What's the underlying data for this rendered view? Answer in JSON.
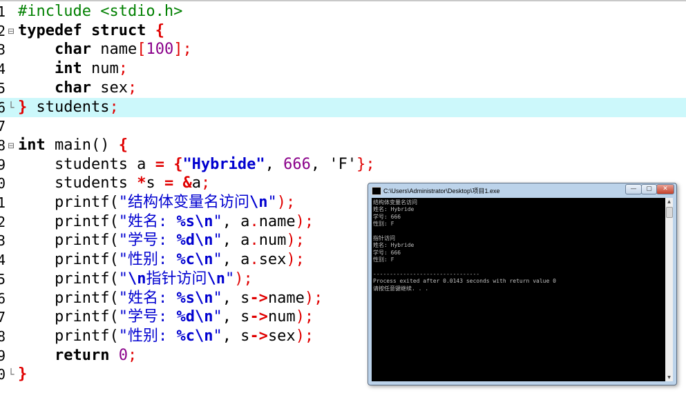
{
  "editor": {
    "lines": [
      {
        "n": "1",
        "fold": "",
        "seg": [
          {
            "t": "#include <stdio.h>",
            "c": "pre"
          }
        ]
      },
      {
        "n": "2",
        "fold": "⊟",
        "seg": [
          {
            "t": "typedef struct ",
            "c": "kw"
          },
          {
            "t": "{",
            "c": "brace"
          }
        ]
      },
      {
        "n": "3",
        "fold": "",
        "seg": [
          {
            "t": "    "
          },
          {
            "t": "char",
            "c": "kw"
          },
          {
            "t": " name"
          },
          {
            "t": "[",
            "c": "punc"
          },
          {
            "t": "100",
            "c": "num"
          },
          {
            "t": "];",
            "c": "punc"
          }
        ]
      },
      {
        "n": "4",
        "fold": "",
        "seg": [
          {
            "t": "    "
          },
          {
            "t": "int",
            "c": "kw"
          },
          {
            "t": " num"
          },
          {
            "t": ";",
            "c": "punc"
          }
        ]
      },
      {
        "n": "5",
        "fold": "",
        "seg": [
          {
            "t": "    "
          },
          {
            "t": "char",
            "c": "kw"
          },
          {
            "t": " sex"
          },
          {
            "t": ";",
            "c": "punc"
          }
        ]
      },
      {
        "n": "6",
        "fold": "└",
        "highlight": true,
        "seg": [
          {
            "t": "}",
            "c": "brace"
          },
          {
            "t": " students"
          },
          {
            "t": ";",
            "c": "punc"
          }
        ]
      },
      {
        "n": "7",
        "fold": "",
        "seg": []
      },
      {
        "n": "8",
        "fold": "⊟",
        "seg": [
          {
            "t": "int",
            "c": "kw"
          },
          {
            "t": " main() "
          },
          {
            "t": "{",
            "c": "brace"
          }
        ]
      },
      {
        "n": "9",
        "fold": "",
        "seg": [
          {
            "t": "    students a "
          },
          {
            "t": "=",
            "c": "op"
          },
          {
            "t": " "
          },
          {
            "t": "{",
            "c": "brace"
          },
          {
            "t": "\"Hybride\"",
            "c": "esc"
          },
          {
            "t": ","
          },
          {
            "t": " 666",
            "c": "num"
          },
          {
            "t": ", 'F'"
          },
          {
            "t": "};",
            "c": "punc"
          }
        ]
      },
      {
        "n": "0",
        "fold": "",
        "seg": [
          {
            "t": "    students "
          },
          {
            "t": "*",
            "c": "op"
          },
          {
            "t": "s "
          },
          {
            "t": "=",
            "c": "op"
          },
          {
            "t": " "
          },
          {
            "t": "&",
            "c": "op"
          },
          {
            "t": "a"
          },
          {
            "t": ";",
            "c": "punc"
          }
        ]
      },
      {
        "n": "1",
        "fold": "",
        "seg": [
          {
            "t": "    printf("
          },
          {
            "t": "\"结构体变量名访问",
            "c": "str"
          },
          {
            "t": "\\n",
            "c": "esc"
          },
          {
            "t": "\"",
            "c": "str"
          },
          {
            "t": ");",
            "c": "punc"
          }
        ]
      },
      {
        "n": "2",
        "fold": "",
        "seg": [
          {
            "t": "    printf("
          },
          {
            "t": "\"姓名: ",
            "c": "str"
          },
          {
            "t": "%s\\n",
            "c": "esc"
          },
          {
            "t": "\"",
            "c": "str"
          },
          {
            "t": ", a"
          },
          {
            "t": ".",
            "c": "punc"
          },
          {
            "t": "name"
          },
          {
            "t": ");",
            "c": "punc"
          }
        ]
      },
      {
        "n": "3",
        "fold": "",
        "seg": [
          {
            "t": "    printf("
          },
          {
            "t": "\"学号: ",
            "c": "str"
          },
          {
            "t": "%d\\n",
            "c": "esc"
          },
          {
            "t": "\"",
            "c": "str"
          },
          {
            "t": ", a"
          },
          {
            "t": ".",
            "c": "punc"
          },
          {
            "t": "num"
          },
          {
            "t": ");",
            "c": "punc"
          }
        ]
      },
      {
        "n": "4",
        "fold": "",
        "seg": [
          {
            "t": "    printf("
          },
          {
            "t": "\"性别: ",
            "c": "str"
          },
          {
            "t": "%c\\n",
            "c": "esc"
          },
          {
            "t": "\"",
            "c": "str"
          },
          {
            "t": ", a"
          },
          {
            "t": ".",
            "c": "punc"
          },
          {
            "t": "sex"
          },
          {
            "t": ");",
            "c": "punc"
          }
        ]
      },
      {
        "n": "5",
        "fold": "",
        "seg": [
          {
            "t": "    printf("
          },
          {
            "t": "\"",
            "c": "str"
          },
          {
            "t": "\\n",
            "c": "esc"
          },
          {
            "t": "指针访问",
            "c": "str"
          },
          {
            "t": "\\n",
            "c": "esc"
          },
          {
            "t": "\"",
            "c": "str"
          },
          {
            "t": ");",
            "c": "punc"
          }
        ]
      },
      {
        "n": "6",
        "fold": "",
        "seg": [
          {
            "t": "    printf("
          },
          {
            "t": "\"姓名: ",
            "c": "str"
          },
          {
            "t": "%s\\n",
            "c": "esc"
          },
          {
            "t": "\"",
            "c": "str"
          },
          {
            "t": ", s"
          },
          {
            "t": "->",
            "c": "op"
          },
          {
            "t": "name"
          },
          {
            "t": ");",
            "c": "punc"
          }
        ]
      },
      {
        "n": "7",
        "fold": "",
        "seg": [
          {
            "t": "    printf("
          },
          {
            "t": "\"学号: ",
            "c": "str"
          },
          {
            "t": "%d\\n",
            "c": "esc"
          },
          {
            "t": "\"",
            "c": "str"
          },
          {
            "t": ", s"
          },
          {
            "t": "->",
            "c": "op"
          },
          {
            "t": "num"
          },
          {
            "t": ");",
            "c": "punc"
          }
        ]
      },
      {
        "n": "8",
        "fold": "",
        "seg": [
          {
            "t": "    printf("
          },
          {
            "t": "\"性别: ",
            "c": "str"
          },
          {
            "t": "%c\\n",
            "c": "esc"
          },
          {
            "t": "\"",
            "c": "str"
          },
          {
            "t": ", s"
          },
          {
            "t": "->",
            "c": "op"
          },
          {
            "t": "sex"
          },
          {
            "t": ");",
            "c": "punc"
          }
        ]
      },
      {
        "n": "9",
        "fold": "",
        "seg": [
          {
            "t": "    "
          },
          {
            "t": "return",
            "c": "kw"
          },
          {
            "t": " 0",
            "c": "num"
          },
          {
            "t": ";",
            "c": "punc"
          }
        ]
      },
      {
        "n": "0",
        "fold": "└",
        "seg": [
          {
            "t": "}",
            "c": "brace"
          }
        ]
      }
    ]
  },
  "console": {
    "title": "C:\\Users\\Administrator\\Desktop\\项目1.exe",
    "buttons": {
      "minimize": "—",
      "maximize": "▢",
      "close": "✕"
    },
    "output": [
      "结构体变量名访问",
      "姓名: Hybride",
      "学号: 666",
      "性别: F",
      "",
      "指针访问",
      "姓名: Hybride",
      "学号: 666",
      "性别: F",
      "",
      "--------------------------------",
      "Process exited after 0.0143 seconds with return value 0",
      "请按任意键继续. . ."
    ],
    "scroll_up": "▲",
    "scroll_down": "▼"
  }
}
